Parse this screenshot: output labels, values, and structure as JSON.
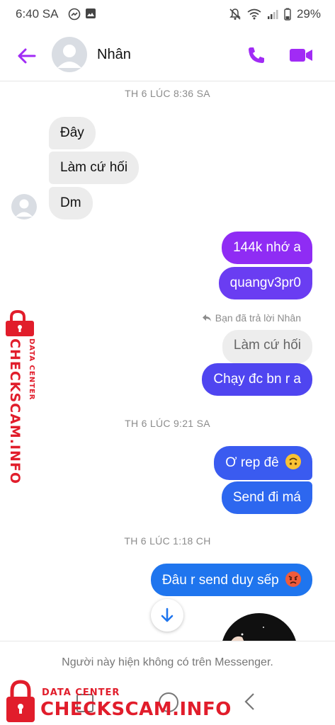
{
  "status_bar": {
    "time": "6:40 SA",
    "battery": "29%",
    "icons": [
      "messenger-icon",
      "image-icon",
      "mute-icon",
      "wifi-icon",
      "signal-icon",
      "battery-icon"
    ]
  },
  "header": {
    "contact_name": "Nhân",
    "back_icon": "arrow-left-icon",
    "call_icon": "phone-icon",
    "video_icon": "video-camera-icon",
    "accent_color": "#a12bf5"
  },
  "chat": {
    "timestamps": [
      "TH 6 LÚC 8:36 SA",
      "TH 6 LÚC 9:21 SA",
      "TH 6 LÚC 1:18 CH"
    ],
    "incoming": [
      "Đây",
      "Làm cứ hối",
      "Dm"
    ],
    "outgoing_group1": [
      "144k nhớ a",
      "quangv3pr0"
    ],
    "reply_note": "Bạn đã trả lời Nhân",
    "quoted_message": "Làm cứ hối",
    "reply_message": "Chạy đc bn r a",
    "outgoing_group2": [
      "Ơ rep đê",
      "Send đi má"
    ],
    "outgoing_group3": [
      "Đâu r send duy sếp"
    ],
    "bubble_colors": {
      "purple": "#8f2cf4",
      "violet": "#6a3df2",
      "indigo": "#4f45f0",
      "blue": "#3a5bf0",
      "blue2": "#2d67ef",
      "blue3": "#1f75ee",
      "incoming": "#ececec"
    }
  },
  "footer": {
    "notice": "Người này hiện không có trên Messenger."
  },
  "watermark": {
    "small": "DATA CENTER",
    "big": "CHECKSCAM.INFO",
    "color": "#e11d2b"
  }
}
